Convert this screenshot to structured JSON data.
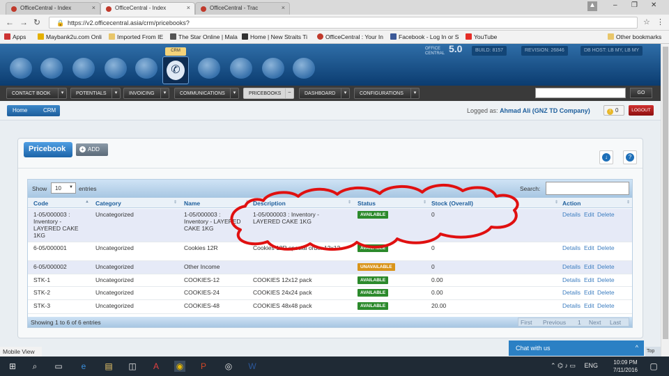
{
  "browser": {
    "tabs": [
      {
        "label": "OfficeCentral - Index"
      },
      {
        "label": "OfficeCentral - Index"
      },
      {
        "label": "OfficeCentral - Trac"
      }
    ],
    "url": "https://v2.officecentral.asia/crm/pricebooks?",
    "bookmarks": [
      {
        "label": "Apps"
      },
      {
        "label": "Maybank2u.com Onli"
      },
      {
        "label": "Imported From IE"
      },
      {
        "label": "The Star Online | Mala"
      },
      {
        "label": "Home | New Straits Ti"
      },
      {
        "label": "OfficeCentral : Your In"
      },
      {
        "label": "Facebook - Log In or S"
      },
      {
        "label": "YouTube"
      },
      {
        "label": "Other bookmarks"
      }
    ]
  },
  "app": {
    "crm_tab": "CRM",
    "logo_line1": "OFFICE",
    "logo_line2": "CENTRAL",
    "logo_version": "5.0",
    "build": "BUILD: 8157",
    "revision": "REVISION: 26846",
    "db_host": "DB HOST: LB MY, LB MY",
    "menu": [
      {
        "label": "CONTACT BOOK"
      },
      {
        "label": "POTENTIALS"
      },
      {
        "label": "INVOICING"
      },
      {
        "label": "COMMUNICATIONS"
      },
      {
        "label": "PRICEBOOKS"
      },
      {
        "label": "DASHBOARD"
      },
      {
        "label": "CONFIGURATIONS"
      }
    ],
    "go_label": "GO",
    "breadcrumb": [
      {
        "label": "Home"
      },
      {
        "label": "CRM"
      }
    ],
    "logged_as_prefix": "Logged as:",
    "logged_as_user": "Ahmad Ali (GNZ TD Company)",
    "notif_count": "0",
    "logout_label": "LOGOUT"
  },
  "panel": {
    "title": "Pricebook",
    "add_label": "ADD",
    "show_label": "Show",
    "show_value": "10",
    "entries_label": "entries",
    "search_label": "Search:",
    "columns": [
      "Code",
      "Category",
      "Name",
      "Description",
      "Status",
      "Stock (Overall)",
      "Action"
    ],
    "rows": [
      {
        "code": "1-05/000003 : Inventory - LAYERED CAKE 1KG",
        "category": "Uncategorized",
        "name": "1-05/000003 : Inventory - LAYERED CAKE 1KG",
        "description": "1-05/000003 : Inventory - LAYERED CAKE 1KG",
        "status": "AVAILABLE",
        "stock": "0",
        "actions": [
          "Details",
          "Edit",
          "Delete"
        ]
      },
      {
        "code": "6-05/000001",
        "category": "Uncategorized",
        "name": "Cookies 12R",
        "description": "Cookies 12R special order 12x12",
        "status": "AVAILABLE",
        "stock": "0",
        "actions": [
          "Details",
          "Edit",
          "Delete"
        ]
      },
      {
        "code": "6-05/000002",
        "category": "Uncategorized",
        "name": "Other Income",
        "description": "",
        "status": "UNAVAILABLE",
        "stock": "0",
        "actions": [
          "Details",
          "Edit",
          "Delete"
        ]
      },
      {
        "code": "STK-1",
        "category": "Uncategorized",
        "name": "COOKIES-12",
        "description": "COOKIES 12x12 pack",
        "status": "AVAILABLE",
        "stock": "0.00",
        "actions": [
          "Details",
          "Edit",
          "Delete"
        ]
      },
      {
        "code": "STK-2",
        "category": "Uncategorized",
        "name": "COOKIES-24",
        "description": "COOKIES 24x24 pack",
        "status": "AVAILABLE",
        "stock": "0.00",
        "actions": [
          "Details",
          "Edit",
          "Delete"
        ]
      },
      {
        "code": "STK-3",
        "category": "Uncategorized",
        "name": "COOKIES-48",
        "description": "COOKIES 48x48 pack",
        "status": "AVAILABLE",
        "stock": "20.00",
        "actions": [
          "Details",
          "Edit",
          "Delete"
        ]
      }
    ],
    "showing": "Showing 1 to 6 of 6 entries",
    "pager": [
      "First",
      "Previous",
      "1",
      "Next",
      "Last"
    ]
  },
  "footer": {
    "mobile_view": "Mobile View",
    "chat_label": "Chat with us",
    "top_label": "Top"
  },
  "taskbar": {
    "lang": "ENG",
    "time": "10:09 PM",
    "date": "7/11/2016"
  },
  "colors": {
    "accent_blue": "#1d64a8",
    "available_green": "#2c8a2c",
    "unavailable_orange": "#d9941a",
    "logout_red": "#b01818",
    "annotation_red": "#e01010"
  }
}
